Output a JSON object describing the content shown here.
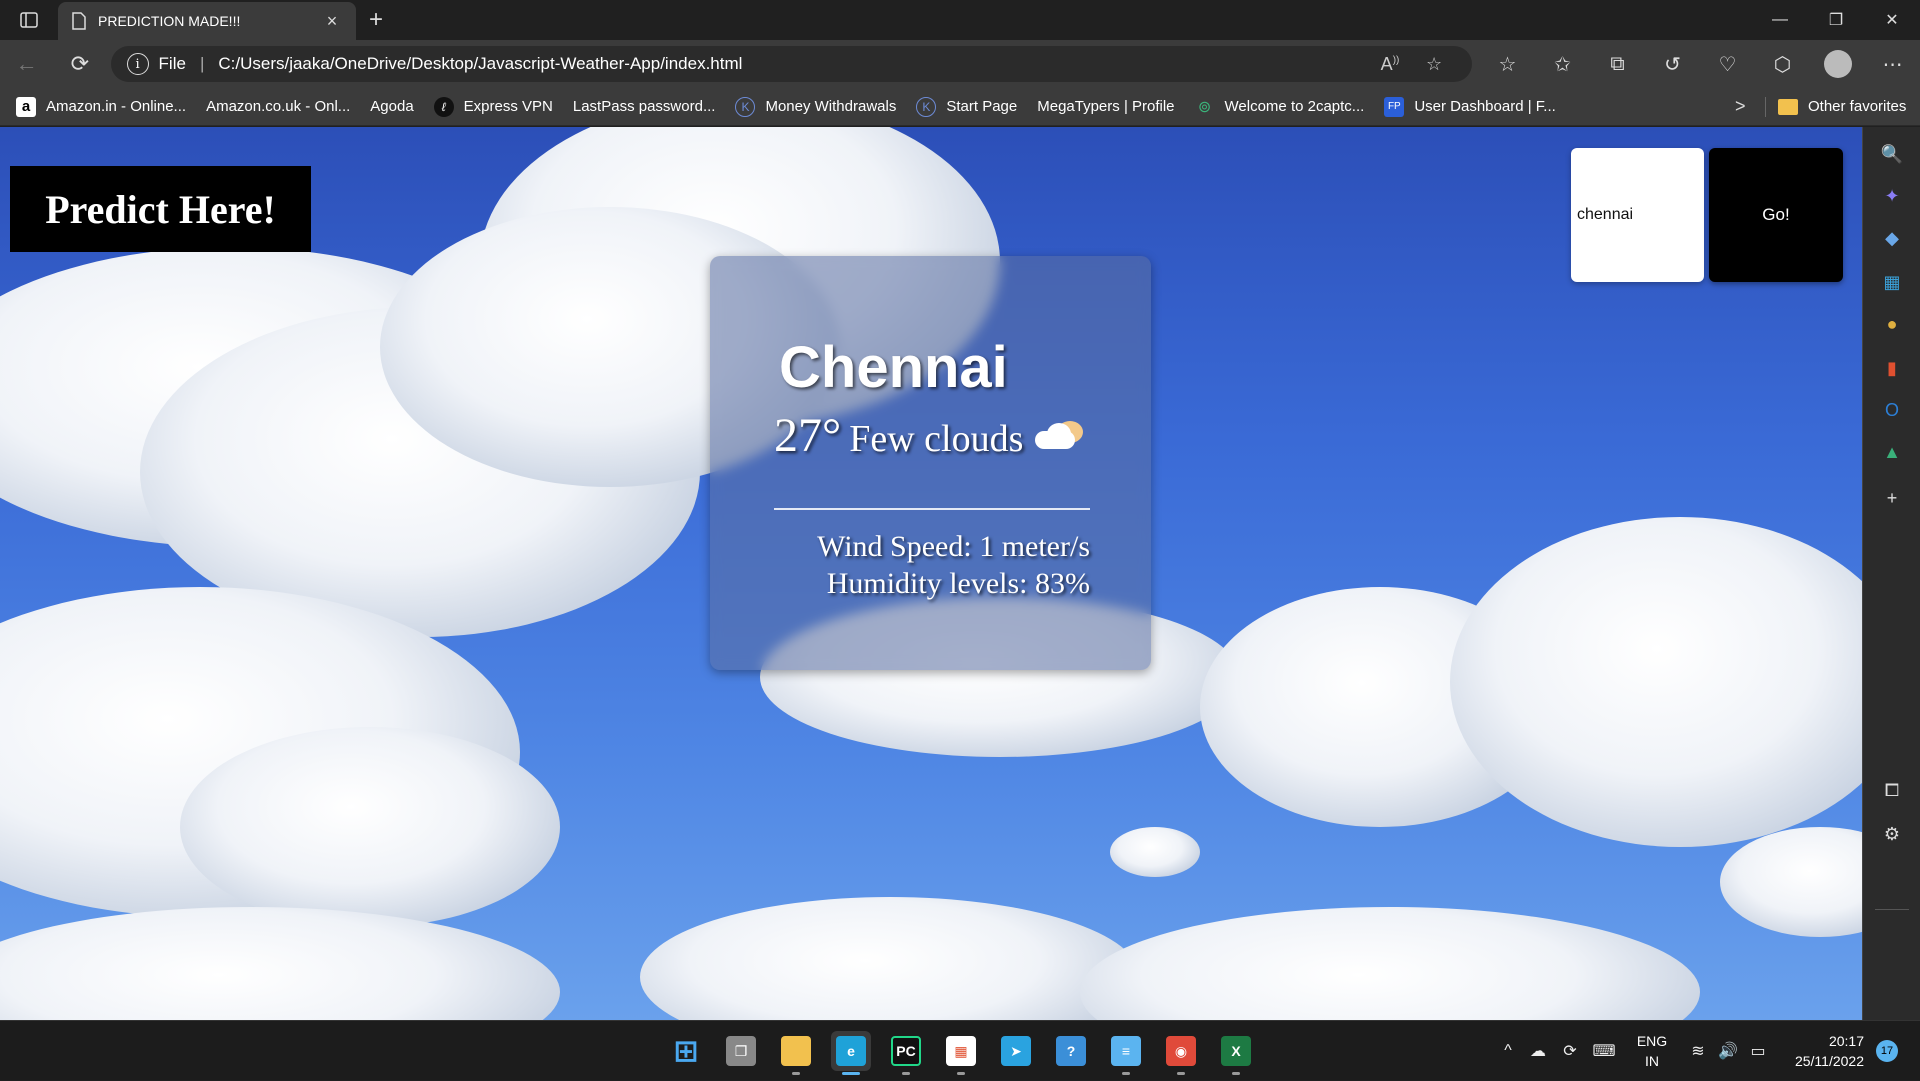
{
  "browser": {
    "tab_title": "PREDICTION MADE!!!",
    "tab_close": "×",
    "new_tab": "+",
    "window_controls": {
      "minimize": "—",
      "restore": "❐",
      "close": "✕"
    },
    "address": {
      "scheme": "File",
      "separator": "|",
      "url": "C:/Users/jaaka/OneDrive/Desktop/Javascript-Weather-App/index.html",
      "read_aloud": "Aͅ",
      "info_icon": "i"
    },
    "nav": {
      "back": "←",
      "refresh": "⟳"
    },
    "toolbar_icons": [
      "favorites-star-add-icon",
      "favorites-icon",
      "collections-icon",
      "history-icon",
      "browser-essentials-icon",
      "extensions-icon",
      "profile-avatar-icon",
      "more-menu-icon"
    ],
    "toolbar_glyphs": [
      "☆",
      "✩",
      "⧉",
      "↺",
      "♡",
      "⬡",
      "",
      "⋯"
    ],
    "favorites": [
      {
        "label": "Amazon.in - Online...",
        "icon": "a"
      },
      {
        "label": "Amazon.co.uk - Onl...",
        "icon": "page"
      },
      {
        "label": "Agoda",
        "icon": "page"
      },
      {
        "label": "Express VPN",
        "icon": "vpn"
      },
      {
        "label": "LastPass password...",
        "icon": "page"
      },
      {
        "label": "Money Withdrawals",
        "icon": "k"
      },
      {
        "label": "Start Page",
        "icon": "k"
      },
      {
        "label": "MegaTypers | Profile",
        "icon": "page"
      },
      {
        "label": "Welcome to 2captc...",
        "icon": "two"
      },
      {
        "label": "User Dashboard | F...",
        "icon": "ud"
      }
    ],
    "favorites_more": ">",
    "other_favorites": "Other favorites"
  },
  "app": {
    "predict_button": "Predict Here!",
    "search_value": "chennai",
    "go_button": "Go!",
    "weather": {
      "city": "Chennai",
      "temperature": "27°",
      "condition": "Few clouds",
      "wind": "Wind Speed: 1 meter/s",
      "humidity": "Humidity levels: 83%"
    }
  },
  "sidebar": {
    "icons": [
      "search-icon",
      "copilot-icon",
      "shopping-tag-icon",
      "tools-icon",
      "games-icon",
      "office-icon",
      "outlook-icon",
      "tree-icon",
      "add-icon",
      "split-screen-icon",
      "settings-icon"
    ],
    "glyphs": [
      "🔍",
      "✦",
      "◆",
      "▦",
      "●",
      "▮",
      "O",
      "▲",
      "+",
      "⧠",
      "⚙"
    ],
    "colors": [
      "#5ab4f0",
      "#8a7df5",
      "#6aa7e8",
      "#3aa0d8",
      "#e0b040",
      "#e05030",
      "#2c7fd6",
      "#3ab07a",
      "#dddddd",
      "#dddddd",
      "#dddddd"
    ]
  },
  "taskbar": {
    "apps": [
      {
        "name": "start-button",
        "glyph": "⊞",
        "color": "#4aa8f0"
      },
      {
        "name": "task-view-icon",
        "glyph": "❐",
        "color": "#888888"
      },
      {
        "name": "file-explorer-icon",
        "glyph": "",
        "color": "#f2c14e"
      },
      {
        "name": "edge-icon",
        "glyph": "e",
        "color": "#1fa2d8"
      },
      {
        "name": "pycharm-icon",
        "glyph": "PC",
        "color": "#111111"
      },
      {
        "name": "microsoft-store-icon",
        "glyph": "▦",
        "color": "#ffffff"
      },
      {
        "name": "telegram-icon",
        "glyph": "➤",
        "color": "#2aa3e0"
      },
      {
        "name": "browser-icon",
        "glyph": "?",
        "color": "#3b8fd8"
      },
      {
        "name": "notepad-icon",
        "glyph": "≡",
        "color": "#5bb4f0"
      },
      {
        "name": "chrome-icon",
        "glyph": "◉",
        "color": "#e04a3a"
      },
      {
        "name": "excel-icon",
        "glyph": "X",
        "color": "#1d7a43"
      }
    ],
    "tray": {
      "chevron": "^",
      "onedrive": "☁",
      "sync": "⟳",
      "keyboard": "⌨",
      "wifi": "≋",
      "volume": "🔊",
      "battery": "▭"
    },
    "language": {
      "line1": "ENG",
      "line2": "IN"
    },
    "time": "20:17",
    "date": "25/11/2022",
    "notifications": "17"
  }
}
